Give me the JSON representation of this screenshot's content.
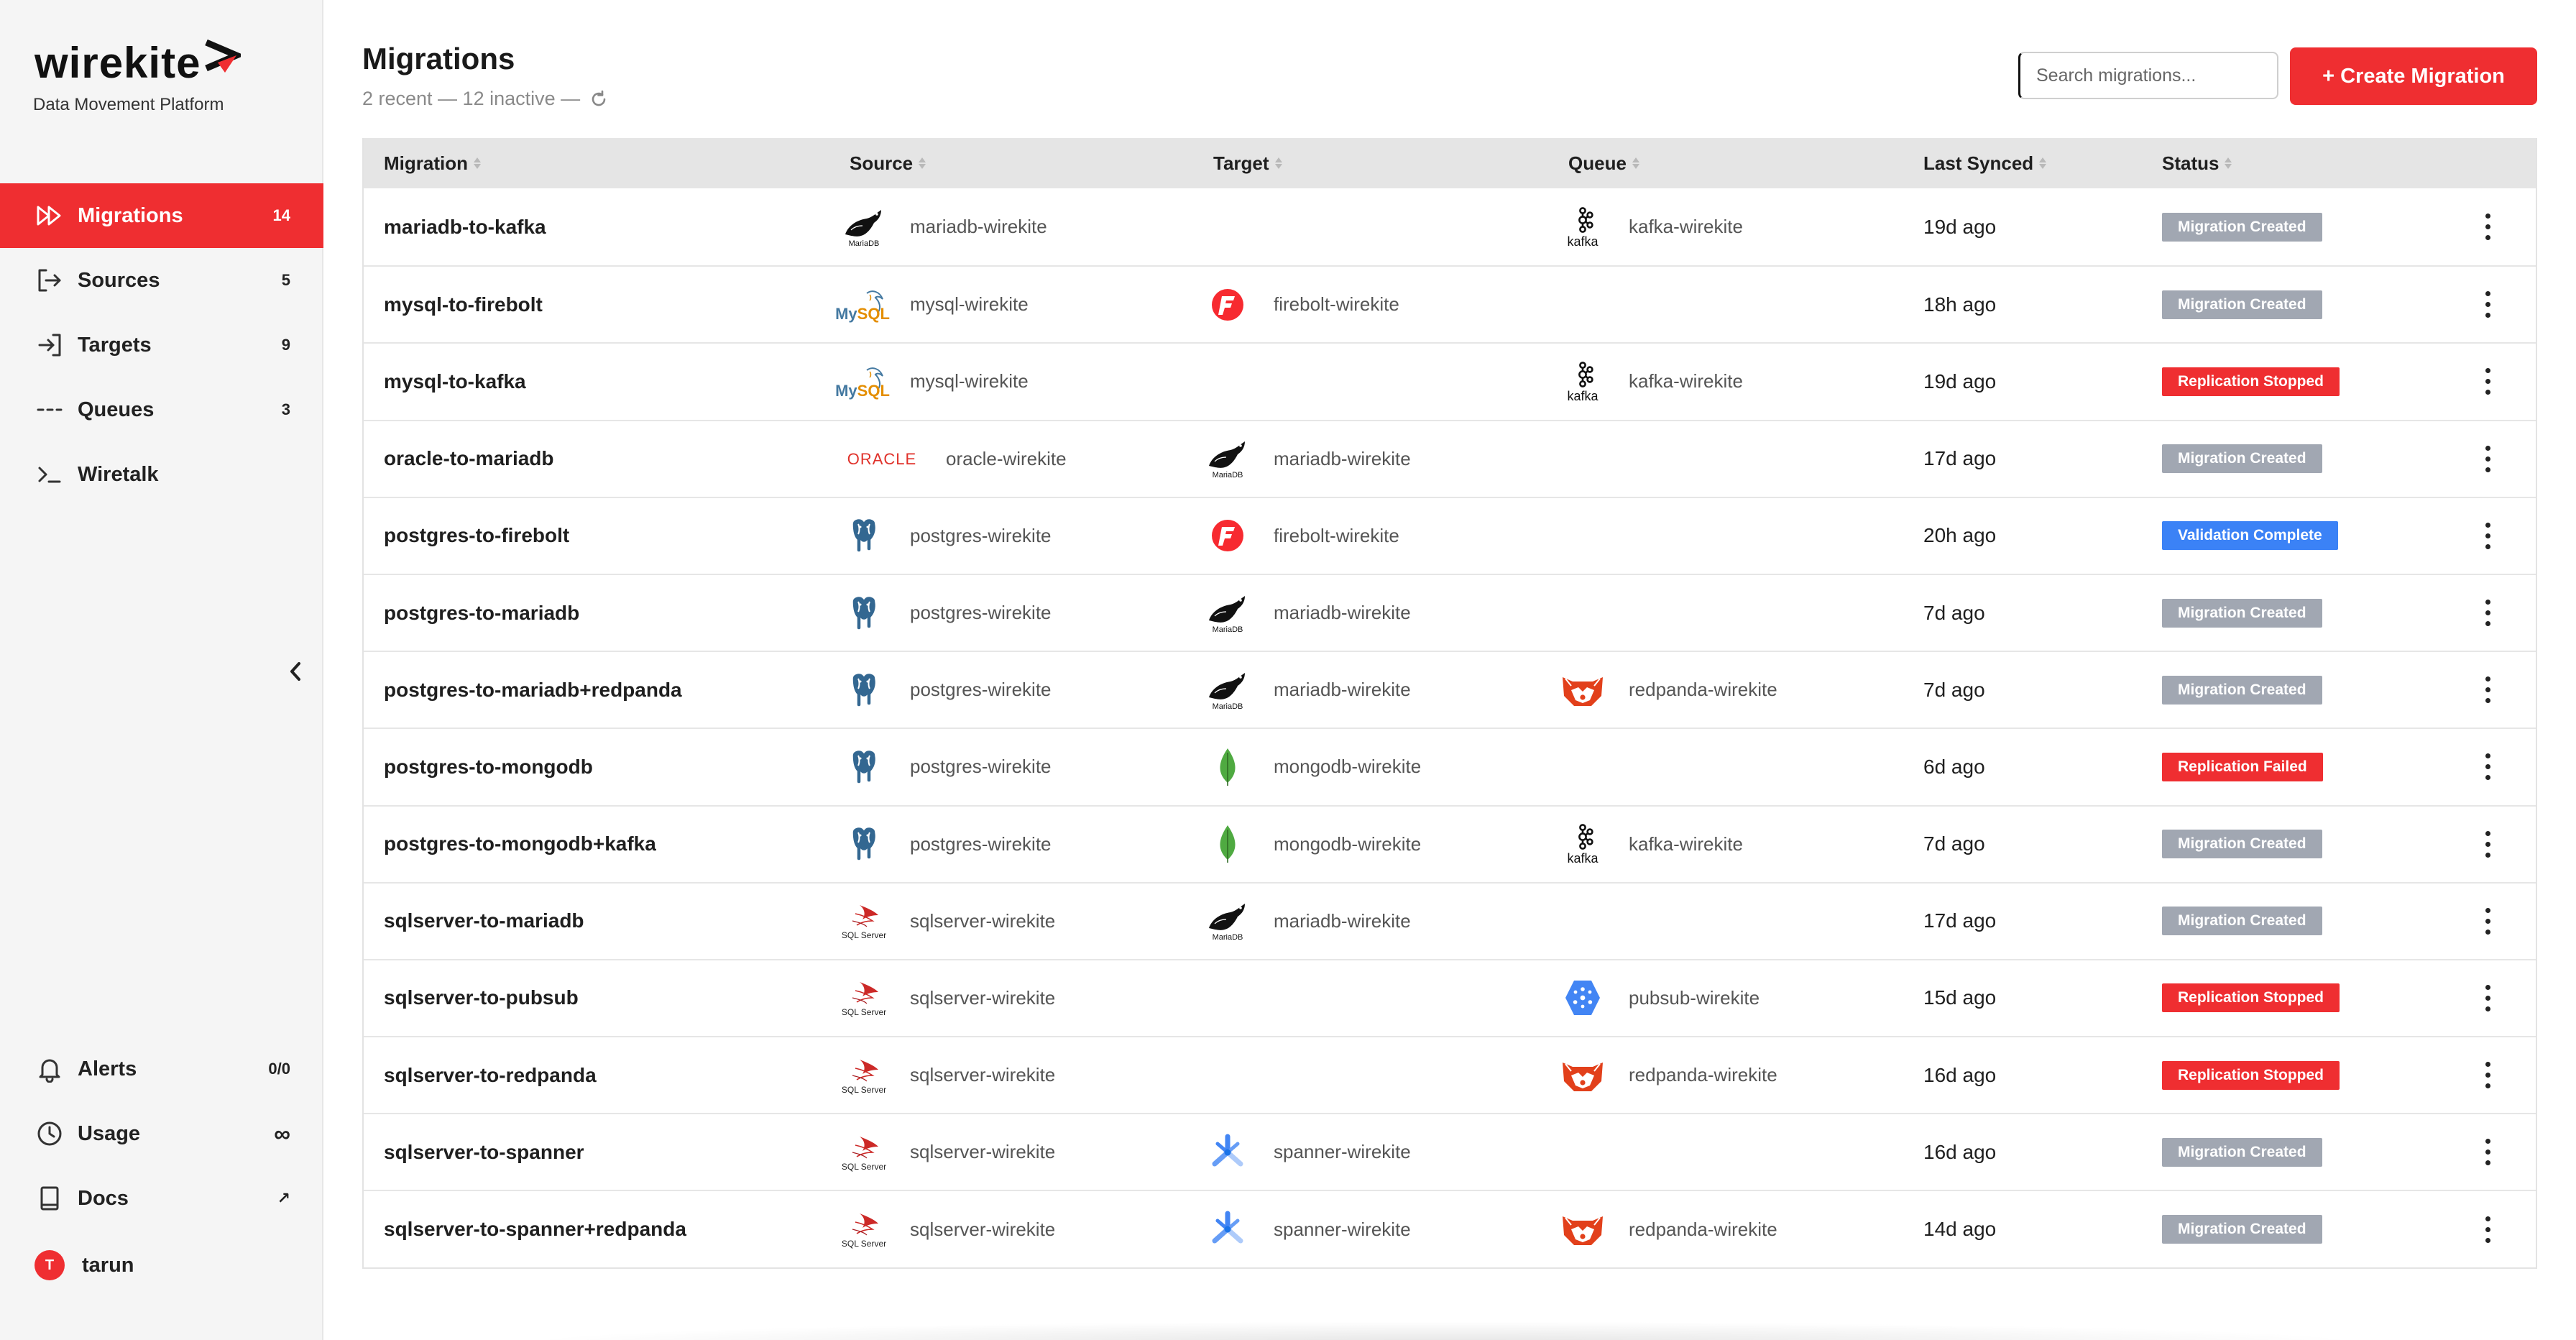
{
  "brand": {
    "name": "wirekite",
    "tagline": "Data Movement Platform",
    "accent": "#ef2e31"
  },
  "nav": {
    "items": [
      {
        "key": "migrations",
        "label": "Migrations",
        "count": "14",
        "icon": "fast-forward-icon",
        "active": true
      },
      {
        "key": "sources",
        "label": "Sources",
        "count": "5",
        "icon": "source-arrow-icon"
      },
      {
        "key": "targets",
        "label": "Targets",
        "count": "9",
        "icon": "target-arrow-icon"
      },
      {
        "key": "queues",
        "label": "Queues",
        "count": "3",
        "icon": "queue-dashes-icon"
      },
      {
        "key": "wiretalk",
        "label": "Wiretalk",
        "count": "",
        "icon": "terminal-icon"
      }
    ],
    "bottom": [
      {
        "key": "alerts",
        "label": "Alerts",
        "count": "0/0",
        "icon": "bell-icon"
      },
      {
        "key": "usage",
        "label": "Usage",
        "count": "∞",
        "icon": "clock-icon"
      },
      {
        "key": "docs",
        "label": "Docs",
        "count": "↗",
        "icon": "book-icon"
      }
    ],
    "user": {
      "initial": "T",
      "name": "tarun"
    }
  },
  "header": {
    "title": "Migrations",
    "subtitle": "2 recent — 12 inactive —",
    "search_placeholder": "Search migrations...",
    "create_label": "+ Create Migration"
  },
  "table": {
    "columns": [
      "Migration",
      "Source",
      "Target",
      "Queue",
      "Last Synced",
      "Status"
    ],
    "status_colors": {
      "Migration Created": "#a1a7b2",
      "Replication Stopped": "#ef2e31",
      "Replication Failed": "#ef2e31",
      "Validation Complete": "#3b82f6"
    },
    "rows": [
      {
        "name": "mariadb-to-kafka",
        "source": "mariadb-wirekite",
        "source_icon": "mariadb-icon",
        "target": "",
        "target_icon": "",
        "queue": "kafka-wirekite",
        "queue_icon": "kafka-icon",
        "synced": "19d ago",
        "status": "Migration Created"
      },
      {
        "name": "mysql-to-firebolt",
        "source": "mysql-wirekite",
        "source_icon": "mysql-icon",
        "target": "firebolt-wirekite",
        "target_icon": "firebolt-icon",
        "queue": "",
        "queue_icon": "",
        "synced": "18h ago",
        "status": "Migration Created"
      },
      {
        "name": "mysql-to-kafka",
        "source": "mysql-wirekite",
        "source_icon": "mysql-icon",
        "target": "",
        "target_icon": "",
        "queue": "kafka-wirekite",
        "queue_icon": "kafka-icon",
        "synced": "19d ago",
        "status": "Replication Stopped"
      },
      {
        "name": "oracle-to-mariadb",
        "source": "oracle-wirekite",
        "source_icon": "oracle-icon",
        "target": "mariadb-wirekite",
        "target_icon": "mariadb-icon",
        "queue": "",
        "queue_icon": "",
        "synced": "17d ago",
        "status": "Migration Created"
      },
      {
        "name": "postgres-to-firebolt",
        "source": "postgres-wirekite",
        "source_icon": "postgres-icon",
        "target": "firebolt-wirekite",
        "target_icon": "firebolt-icon",
        "queue": "",
        "queue_icon": "",
        "synced": "20h ago",
        "status": "Validation Complete"
      },
      {
        "name": "postgres-to-mariadb",
        "source": "postgres-wirekite",
        "source_icon": "postgres-icon",
        "target": "mariadb-wirekite",
        "target_icon": "mariadb-icon",
        "queue": "",
        "queue_icon": "",
        "synced": "7d ago",
        "status": "Migration Created"
      },
      {
        "name": "postgres-to-mariadb+redpanda",
        "source": "postgres-wirekite",
        "source_icon": "postgres-icon",
        "target": "mariadb-wirekite",
        "target_icon": "mariadb-icon",
        "queue": "redpanda-wirekite",
        "queue_icon": "redpanda-icon",
        "synced": "7d ago",
        "status": "Migration Created"
      },
      {
        "name": "postgres-to-mongodb",
        "source": "postgres-wirekite",
        "source_icon": "postgres-icon",
        "target": "mongodb-wirekite",
        "target_icon": "mongodb-icon",
        "queue": "",
        "queue_icon": "",
        "synced": "6d ago",
        "status": "Replication Failed"
      },
      {
        "name": "postgres-to-mongodb+kafka",
        "source": "postgres-wirekite",
        "source_icon": "postgres-icon",
        "target": "mongodb-wirekite",
        "target_icon": "mongodb-icon",
        "queue": "kafka-wirekite",
        "queue_icon": "kafka-icon",
        "synced": "7d ago",
        "status": "Migration Created"
      },
      {
        "name": "sqlserver-to-mariadb",
        "source": "sqlserver-wirekite",
        "source_icon": "sqlserver-icon",
        "target": "mariadb-wirekite",
        "target_icon": "mariadb-icon",
        "queue": "",
        "queue_icon": "",
        "synced": "17d ago",
        "status": "Migration Created"
      },
      {
        "name": "sqlserver-to-pubsub",
        "source": "sqlserver-wirekite",
        "source_icon": "sqlserver-icon",
        "target": "",
        "target_icon": "",
        "queue": "pubsub-wirekite",
        "queue_icon": "pubsub-icon",
        "synced": "15d ago",
        "status": "Replication Stopped"
      },
      {
        "name": "sqlserver-to-redpanda",
        "source": "sqlserver-wirekite",
        "source_icon": "sqlserver-icon",
        "target": "",
        "target_icon": "",
        "queue": "redpanda-wirekite",
        "queue_icon": "redpanda-icon",
        "synced": "16d ago",
        "status": "Replication Stopped"
      },
      {
        "name": "sqlserver-to-spanner",
        "source": "sqlserver-wirekite",
        "source_icon": "sqlserver-icon",
        "target": "spanner-wirekite",
        "target_icon": "spanner-icon",
        "queue": "",
        "queue_icon": "",
        "synced": "16d ago",
        "status": "Migration Created"
      },
      {
        "name": "sqlserver-to-spanner+redpanda",
        "source": "sqlserver-wirekite",
        "source_icon": "sqlserver-icon",
        "target": "spanner-wirekite",
        "target_icon": "spanner-icon",
        "queue": "redpanda-wirekite",
        "queue_icon": "redpanda-icon",
        "synced": "14d ago",
        "status": "Migration Created"
      }
    ]
  },
  "logo_labels": {
    "mariadb": "MariaDB",
    "mysql": "MySQL",
    "oracle": "ORACLE",
    "kafka": "kafka",
    "sqlserver": "SQL Server"
  }
}
